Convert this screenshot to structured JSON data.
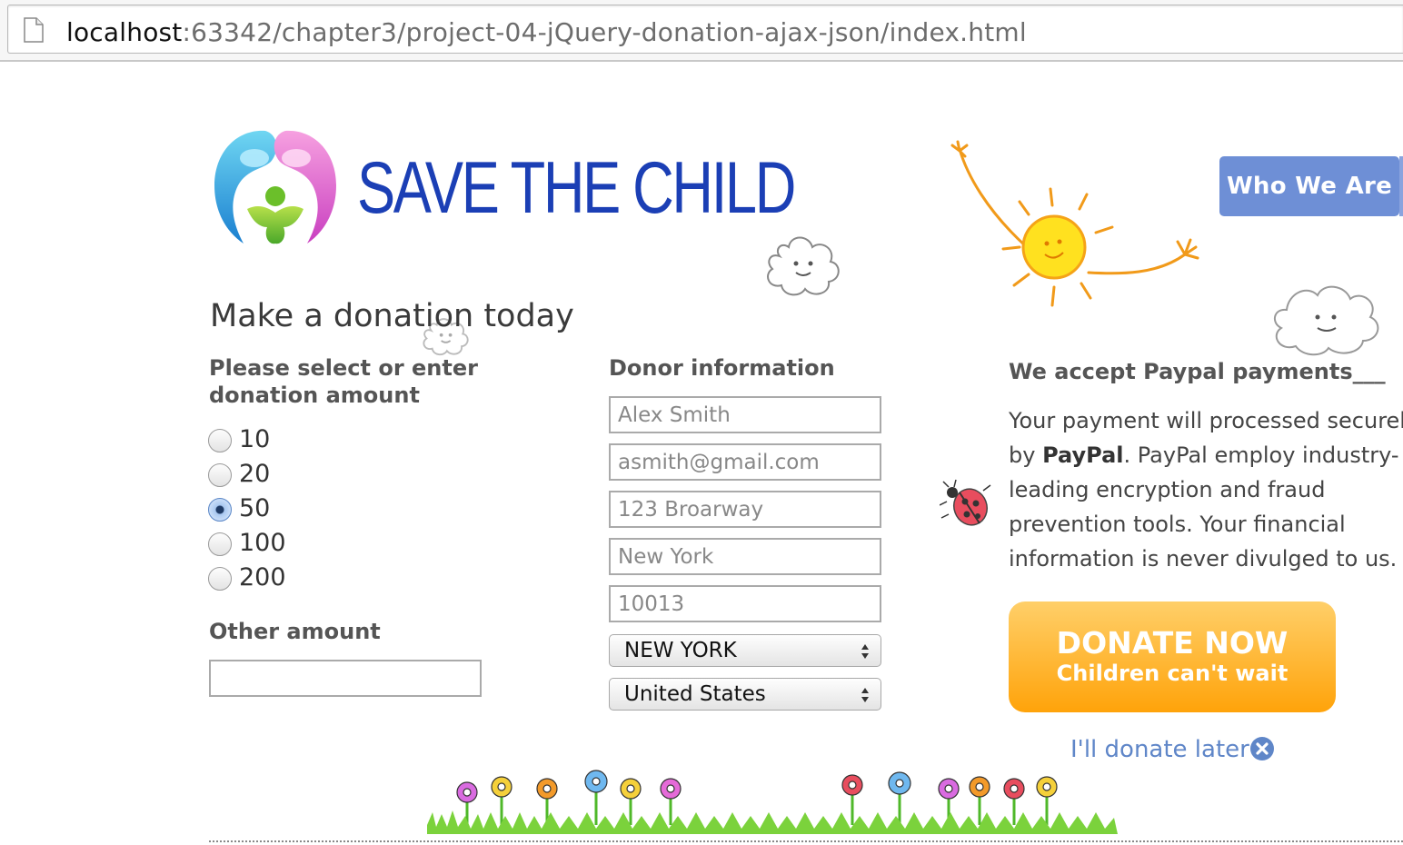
{
  "browser": {
    "url_host": "localhost",
    "url_path": ":63342/chapter3/project-04-jQuery-donation-ajax-json/index.html",
    "page_icon": "document-icon"
  },
  "header": {
    "logo_text": "SAVE THE CHILD",
    "nav_button": "Who We Are"
  },
  "form": {
    "title": "Make a donation today",
    "amount_label": "Please select or enter donation amount",
    "amounts": [
      "10",
      "20",
      "50",
      "100",
      "200"
    ],
    "selected_amount": "50",
    "other_label": "Other amount",
    "other_value": "",
    "donor_label": "Donor information",
    "donor_fields": {
      "name_placeholder": "Alex Smith",
      "email_placeholder": "asmith@gmail.com",
      "address_placeholder": "123 Broarway",
      "city_placeholder": "New York",
      "zip_placeholder": "10013"
    },
    "state_selected": "NEW YORK",
    "country_selected": "United States"
  },
  "paypal": {
    "heading": "We accept Paypal payments___",
    "line1": "Your payment will processed securely",
    "line2_pre": "by ",
    "line2_bold": "PayPal",
    "line2_post": ". PayPal employ industry-",
    "line3": "leading encryption and fraud",
    "line4": "prevention tools. Your financial",
    "line5": "information is never divulged to us."
  },
  "donate": {
    "main": "DONATE NOW",
    "sub": "Children can't wait",
    "later": "I'll donate later"
  },
  "colors": {
    "brand_blue": "#1b3fb5",
    "nav_blue": "#6e8fd6",
    "donate_orange": "#ffa30a",
    "link_blue": "#5f86c8"
  }
}
